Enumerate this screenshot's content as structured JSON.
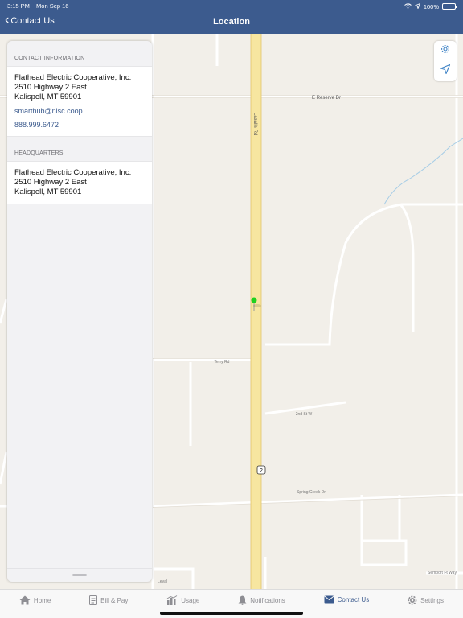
{
  "status_bar": {
    "time": "3:15 PM",
    "date": "Mon Sep 16",
    "battery": "100%"
  },
  "nav": {
    "back_label": "Contact Us",
    "title": "Location"
  },
  "panel": {
    "contact_header": "CONTACT INFORMATION",
    "contact": {
      "name": "Flathead Electric Cooperative, Inc.",
      "street": "2510 Highway 2 East",
      "city": "Kalispell, MT 59901",
      "email": "smarthub@nisc.coop",
      "phone": "888.999.6472"
    },
    "hq_header": "HEADQUARTERS",
    "hq": {
      "name": "Flathead Electric Cooperative, Inc.",
      "street": "2510 Highway 2 East",
      "city": "Kalispell, MT 59901"
    }
  },
  "map": {
    "labels": {
      "reserve": "E Reserve Dr",
      "lasalle": "Lasalle Rd",
      "terry": "Terry Rd",
      "second": "2nd St W",
      "springcreek": "Spring Creek Dr",
      "highway_shield": "2",
      "bottom_left": "Leval",
      "bottom_right": "Semport Ft Way"
    },
    "pin_color": "#1fd11f"
  },
  "tabs": [
    {
      "label": "Home",
      "icon": "home-icon"
    },
    {
      "label": "Bill & Pay",
      "icon": "bill-icon"
    },
    {
      "label": "Usage",
      "icon": "usage-icon"
    },
    {
      "label": "Notifications",
      "icon": "bell-icon"
    },
    {
      "label": "Contact Us",
      "icon": "envelope-icon",
      "active": true
    },
    {
      "label": "Settings",
      "icon": "gear-icon"
    }
  ]
}
